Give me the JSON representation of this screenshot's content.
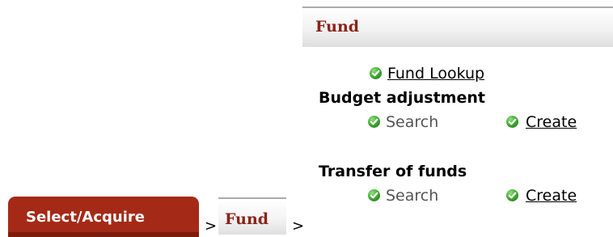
{
  "panel": {
    "title": "Fund",
    "fund_lookup_label": "Fund Lookup",
    "sections": [
      {
        "heading": "Budget adjustment",
        "search_label": "Search",
        "create_label": "Create"
      },
      {
        "heading": "Transfer of funds",
        "search_label": "Search",
        "create_label": "Create"
      }
    ]
  },
  "breadcrumb": {
    "primary_tab": "Select/Acquire",
    "separator": ">",
    "secondary_tab": "Fund"
  },
  "colors": {
    "title_text": "#8b2318",
    "primary_tab_bg": "#a42a17",
    "check_green": "#3aa02c"
  },
  "icons": {
    "status": "check-circle-icon"
  }
}
